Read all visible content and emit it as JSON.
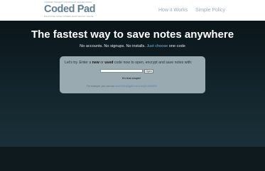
{
  "header": {
    "logo": {
      "tagline_top": "INTERNET SECURITY ANONYMOUS SECURE NOTES",
      "wordmark": "Coded Pad",
      "trademark": "TM",
      "tagline_bottom": "ENCRYPTED NOTES STORED ANONYMOUSLY ONLINE"
    },
    "nav": [
      {
        "label": "How it Works"
      },
      {
        "label": "Simple Policy"
      }
    ]
  },
  "hero": {
    "headline": "The fastest way to save notes anywhere",
    "subline_prefix": "No accounts. No signups. No installs.",
    "subline_accent": "Just choose",
    "subline_suffix": "one code"
  },
  "card": {
    "intro_1": "Let's try. Enter a ",
    "intro_new": "new",
    "intro_2": " or ",
    "intro_used": "used",
    "intro_3": " code now to open, encrypt and save notes with:",
    "code_input": {
      "value": "",
      "placeholder": ""
    },
    "open_button": "Open",
    "simple_text": "It's that simple!",
    "example_prefix": "For example, you can use",
    "example_code": "aibe9Xelbq9gy8s0ne0ciang9u1698898"
  },
  "colors": {
    "background": "#0f1a1e",
    "card": "#99abb0",
    "accent": "#79b7e3",
    "logo": "#5f7e95"
  }
}
